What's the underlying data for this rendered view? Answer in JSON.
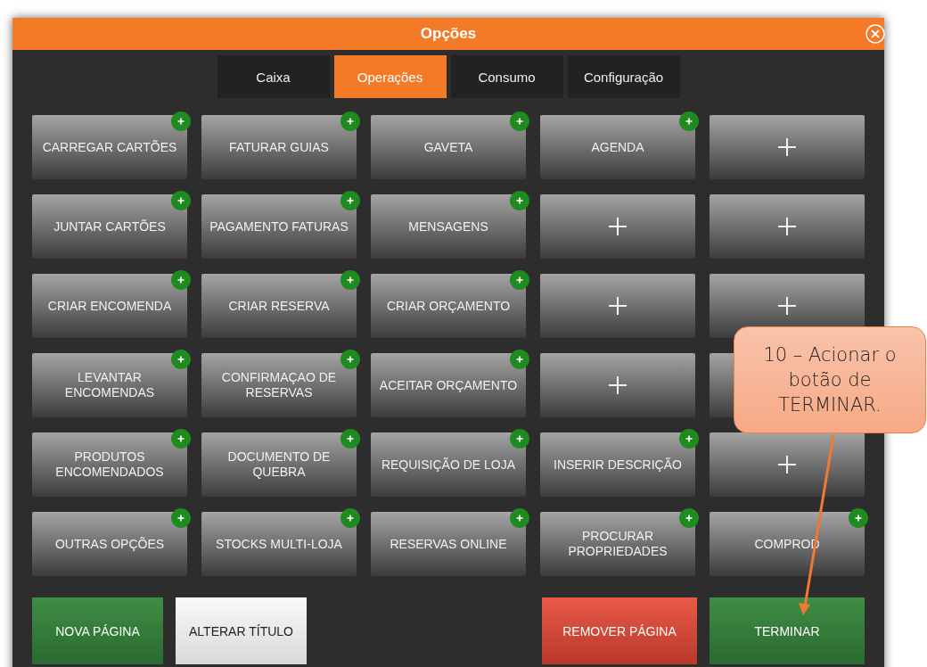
{
  "window": {
    "title": "Opções"
  },
  "tabs": [
    {
      "label": "Caixa",
      "selected": false
    },
    {
      "label": "Operações",
      "selected": true
    },
    {
      "label": "Consumo",
      "selected": false
    },
    {
      "label": "Configuração",
      "selected": false
    }
  ],
  "grid": [
    [
      {
        "kind": "action",
        "label": "CARREGAR CARTÕES"
      },
      {
        "kind": "action",
        "label": "FATURAR GUIAS"
      },
      {
        "kind": "action",
        "label": "GAVETA"
      },
      {
        "kind": "action",
        "label": "AGENDA"
      },
      {
        "kind": "empty"
      }
    ],
    [
      {
        "kind": "action",
        "label": "JUNTAR CARTÕES"
      },
      {
        "kind": "action",
        "label": "PAGAMENTO FATURAS"
      },
      {
        "kind": "action",
        "label": "MENSAGENS"
      },
      {
        "kind": "empty"
      },
      {
        "kind": "empty"
      }
    ],
    [
      {
        "kind": "action",
        "label": "CRIAR ENCOMENDA"
      },
      {
        "kind": "action",
        "label": "CRIAR RESERVA"
      },
      {
        "kind": "action",
        "label": "CRIAR ORÇAMENTO"
      },
      {
        "kind": "empty"
      },
      {
        "kind": "empty"
      }
    ],
    [
      {
        "kind": "action",
        "label": "LEVANTAR ENCOMENDAS"
      },
      {
        "kind": "action",
        "label": "CONFIRMAÇAO DE RESERVAS"
      },
      {
        "kind": "action",
        "label": "ACEITAR ORÇAMENTO"
      },
      {
        "kind": "empty"
      },
      {
        "kind": "covered"
      }
    ],
    [
      {
        "kind": "action",
        "label": "PRODUTOS ENCOMENDADOS"
      },
      {
        "kind": "action",
        "label": "DOCUMENTO DE QUEBRA"
      },
      {
        "kind": "action",
        "label": "REQUISIÇÃO DE LOJA"
      },
      {
        "kind": "action",
        "label": "INSERIR DESCRIÇÃO"
      },
      {
        "kind": "empty"
      }
    ],
    [
      {
        "kind": "action",
        "label": "OUTRAS OPÇÕES"
      },
      {
        "kind": "action",
        "label": "STOCKS MULTI-LOJA"
      },
      {
        "kind": "action",
        "label": "RESERVAS ONLINE"
      },
      {
        "kind": "action",
        "label": "PROCURAR PROPRIEDADES"
      },
      {
        "kind": "action",
        "label": "COMPROD"
      }
    ]
  ],
  "footer_buttons": [
    {
      "label": "NOVA PÁGINA",
      "kind": "success"
    },
    {
      "label": "ALTERAR TÍTULO",
      "kind": "neutral"
    },
    {
      "label": "REMOVER PÁGINA",
      "kind": "danger"
    },
    {
      "label": "TERMINAR",
      "kind": "success"
    }
  ],
  "callout": {
    "text": "10 – Acionar o botão de TERMINAR."
  }
}
